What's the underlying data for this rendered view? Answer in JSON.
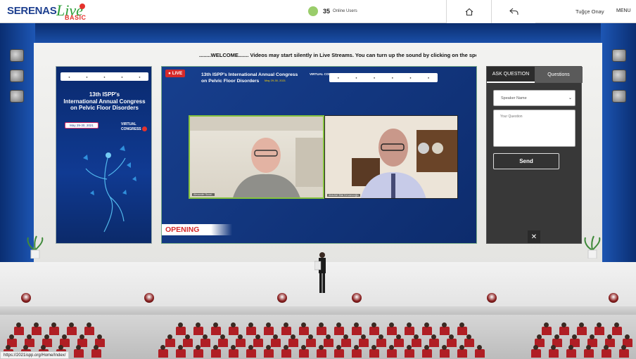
{
  "header": {
    "logo_text": "SERENAS",
    "logo_live": "Live",
    "logo_basic": "BASIC",
    "online_count": "35",
    "online_label": "Online Users",
    "home_icon": "home-icon",
    "back_icon": "reply-arrow-icon",
    "user_name": "Tuğçe Onay",
    "menu_label": "MENU"
  },
  "marquee": {
    "text": "........WELCOME....... Videos may start silently in Live Streams. You can turn up the sound by clicking on the speaker (Click to Un"
  },
  "poster": {
    "title_line1": "13th ISPP's",
    "title_line2": "International Annual Congress",
    "title_line3": "on Pelvic Floor Disorders",
    "date": "May 29-30, 2021",
    "virtual_label": "VIRTUAL CONGRESS"
  },
  "screen": {
    "live_label": "LIVE",
    "title_line1": "13th ISPP's International Annual Congress",
    "title_line2": "on Pelvic Floor Disorders",
    "date": "May 29-30, 2021",
    "virtual_label": "VIRTUAL CONGRESS",
    "video1_name": "Alexander Suvai...",
    "video2_name": "Abdullah Bilal Kervancıoğlu",
    "opening_label": "OPENING"
  },
  "panel": {
    "tab_ask": "ASK QUESTION",
    "tab_questions": "Questions",
    "speaker_placeholder": "Speaker Name",
    "question_placeholder": "Your Question",
    "send_label": "Send",
    "close_label": "✕"
  },
  "status_bar": {
    "url": "https://2021ispp.org/Home/Index/"
  },
  "colors": {
    "wall_blue": "#1d56b4",
    "live_red": "#d52a2a",
    "online_green": "#9acd6b",
    "panel_dark": "#383838"
  }
}
